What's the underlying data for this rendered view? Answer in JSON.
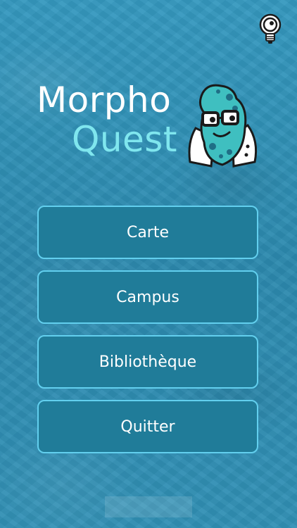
{
  "app": {
    "title_line1": "Morpho",
    "title_line2": "Quest"
  },
  "colors": {
    "background": "#2f8fb4",
    "button_fill": "#207c99",
    "button_border": "#62cfee",
    "title_primary": "#ffffff",
    "title_accent": "#7fe6ee"
  },
  "top_right_icon": "lightbulb-hint-icon",
  "mascot_icon": "microbe-scientist-mascot",
  "menu": {
    "items": [
      {
        "label": "Carte"
      },
      {
        "label": "Campus"
      },
      {
        "label": "Bibliothèque"
      },
      {
        "label": "Quitter"
      }
    ]
  }
}
